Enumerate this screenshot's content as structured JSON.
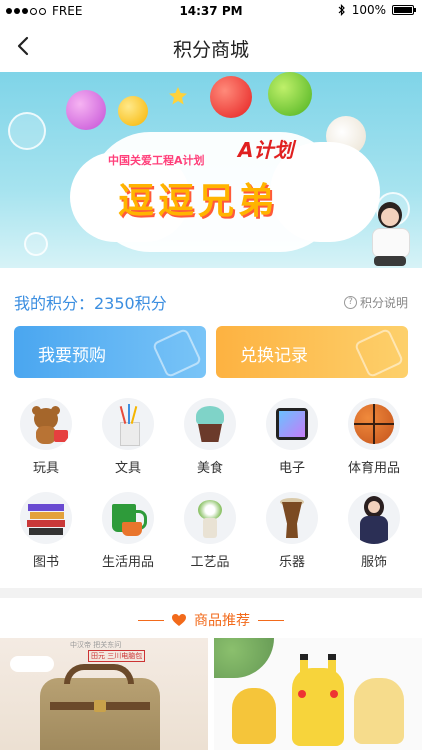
{
  "status_bar": {
    "carrier": "FREE",
    "time": "14:37 PM",
    "battery": "100%"
  },
  "nav": {
    "title": "积分商城"
  },
  "banner": {
    "subtitle": "中国关爱工程A计划",
    "headline": "逗逗兄弟",
    "logo_text": "A计划",
    "slide_count": 4,
    "active_slide": 2
  },
  "points": {
    "label": "我的积分：2350积分",
    "help_label": "积分说明"
  },
  "actions": {
    "preorder_label": "我要预购",
    "exchange_label": "兑换记录"
  },
  "categories": [
    {
      "name": "toy",
      "label": "玩具"
    },
    {
      "name": "stationery",
      "label": "文具"
    },
    {
      "name": "food",
      "label": "美食"
    },
    {
      "name": "electronics",
      "label": "电子"
    },
    {
      "name": "sports",
      "label": "体育用品"
    },
    {
      "name": "books",
      "label": "图书"
    },
    {
      "name": "daily-goods",
      "label": "生活用品"
    },
    {
      "name": "crafts",
      "label": "工艺品"
    },
    {
      "name": "instruments",
      "label": "乐器"
    },
    {
      "name": "clothing",
      "label": "服饰"
    }
  ],
  "recommend": {
    "title": "商品推荐",
    "products": [
      {
        "caption_line1": "中汉帝 把关东问",
        "caption_line2": "田元 三川电脑包"
      },
      {
        "caption_line1": "",
        "caption_line2": ""
      }
    ]
  },
  "colors": {
    "accent_blue": "#3b8ee0",
    "accent_orange": "#f26a1b",
    "preorder_start": "#4aa6f0",
    "exchange_start": "#fdb241"
  }
}
